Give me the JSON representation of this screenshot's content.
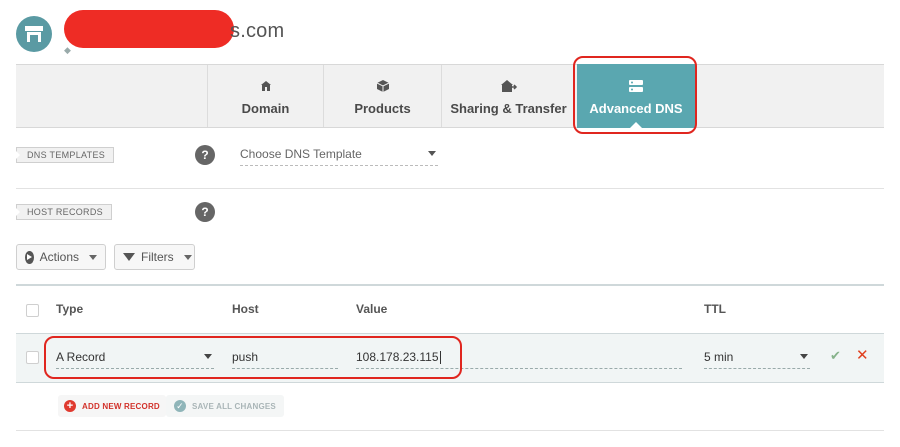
{
  "header": {
    "domain_visible_suffix": "s.com",
    "icons": {
      "avatar": "store-icon",
      "tag": "tag-icon"
    }
  },
  "tabs": [
    {
      "label": "Domain",
      "icon": "home-icon",
      "active": false
    },
    {
      "label": "Products",
      "icon": "box-icon",
      "active": false
    },
    {
      "label": "Sharing & Transfer",
      "icon": "share-transfer-icon",
      "active": false
    },
    {
      "label": "Advanced DNS",
      "icon": "dns-server-icon",
      "active": true
    }
  ],
  "dns_templates": {
    "label": "DNS TEMPLATES",
    "help": "?",
    "select_value": "Choose DNS Template"
  },
  "host_records": {
    "label": "HOST RECORDS",
    "help": "?"
  },
  "toolbar": {
    "actions_label": "Actions",
    "filters_label": "Filters"
  },
  "table": {
    "columns": {
      "type": "Type",
      "host": "Host",
      "value": "Value",
      "ttl": "TTL"
    },
    "row": {
      "type": "A Record",
      "host": "push",
      "value": "108.178.23.115",
      "ttl": "5 min"
    }
  },
  "footer": {
    "add_label": "ADD NEW RECORD",
    "save_label": "SAVE ALL CHANGES"
  },
  "colors": {
    "accent": "#5aa7b0",
    "highlight": "#e0261f",
    "redaction": "#ee2c25",
    "delete": "#e0401f",
    "confirm": "#86b28a"
  }
}
